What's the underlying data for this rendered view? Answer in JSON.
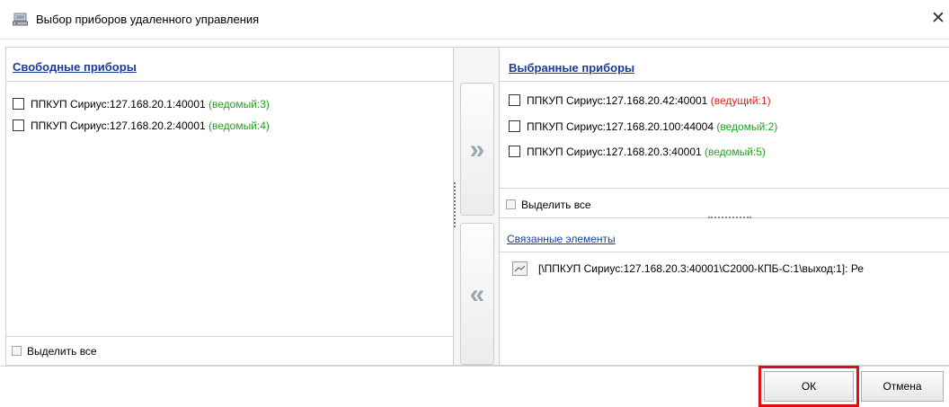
{
  "window": {
    "title": "Выбор приборов удаленного управления",
    "close_glyph": "✕",
    "icon": "devices-window-icon"
  },
  "free_devices": {
    "header": "Свободные приборы",
    "items": [
      {
        "label": "ППКУП Сириус:127.168.20.1:40001",
        "role": "(ведомый:3)",
        "checked": false
      },
      {
        "label": "ППКУП Сириус:127.168.20.2:40001",
        "role": "(ведомый:4)",
        "checked": false
      }
    ],
    "select_all": "Выделить все"
  },
  "transfer": {
    "move_right": "»",
    "move_left": "«"
  },
  "selected_devices": {
    "header": "Выбранные приборы",
    "items": [
      {
        "label": "ППКУП Сириус:127.168.20.42:40001",
        "role": "(ведущий:1)",
        "checked": false
      },
      {
        "label": "ППКУП Сириус:127.168.20.100:44004",
        "role": "(ведомый:2)",
        "checked": false
      },
      {
        "label": "ППКУП Сириус:127.168.20.3:40001",
        "role": "(ведомый:5)",
        "checked": false
      }
    ],
    "select_all": "Выделить все"
  },
  "linked_elements": {
    "header": "Связанные элементы",
    "items": [
      {
        "label": "[\\ППКУП Сириус:127.168.20.3:40001\\С2000-КПБ-С:1\\выход:1]: Ре",
        "icon": "output-signal-icon"
      }
    ]
  },
  "buttons": {
    "ok": "ОК",
    "cancel": "Отмена"
  },
  "colors": {
    "link": "#1a3b9c",
    "slave_role": "#21a121",
    "master_role": "#e02020",
    "ok_highlight": "#e01010"
  }
}
